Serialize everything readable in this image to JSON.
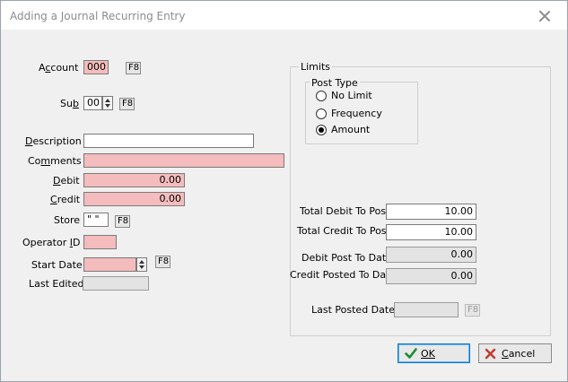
{
  "window": {
    "title": "Adding a Journal Recurring Entry"
  },
  "form": {
    "account": {
      "label": "Account",
      "value": "000",
      "lookup": "F8"
    },
    "sub": {
      "label": "Sub",
      "value": "00",
      "lookup": "F8"
    },
    "description": {
      "label": "Description",
      "value": ""
    },
    "comments": {
      "label": "Comments",
      "value": ""
    },
    "debit": {
      "label": "Debit",
      "value": "0.00"
    },
    "credit": {
      "label": "Credit",
      "value": "0.00"
    },
    "store": {
      "label": "Store",
      "value": "\" \"",
      "lookup": "F8"
    },
    "operator_id": {
      "label": "Operator ID",
      "value": ""
    },
    "start_date": {
      "label": "Start Date",
      "value": "",
      "lookup": "F8"
    },
    "last_edited": {
      "label": "Last Edited",
      "value": ""
    }
  },
  "limits": {
    "title": "Limits",
    "post_type": {
      "title": "Post Type",
      "options": [
        "No Limit",
        "Frequency",
        "Amount"
      ],
      "selected": "Amount"
    },
    "total_debit_to_post": {
      "label": "Total Debit To Post",
      "value": "10.00"
    },
    "total_credit_to_post": {
      "label": "Total Credit To Post",
      "value": "10.00"
    },
    "debit_post_to_date": {
      "label": "Debit Post To Date",
      "value": "0.00"
    },
    "credit_posted_to_date": {
      "label": "Credit Posted To Date",
      "value": "0.00"
    },
    "last_posted_date": {
      "label": "Last Posted Date",
      "value": "",
      "lookup": "F8"
    }
  },
  "buttons": {
    "ok": "OK",
    "cancel": "Cancel"
  },
  "colors": {
    "required_field": "#f4bcbc",
    "disabled_field": "#e3e3e3",
    "focus_border": "#0078d7"
  }
}
